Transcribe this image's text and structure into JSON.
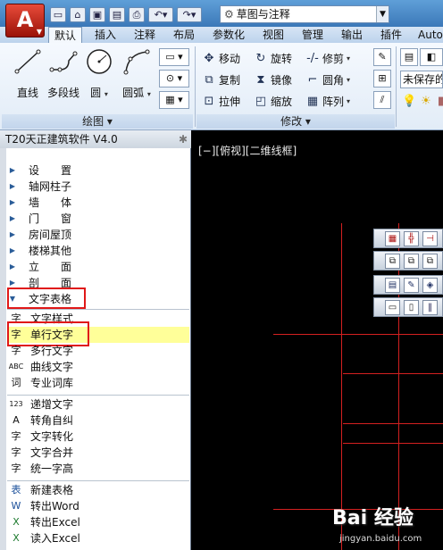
{
  "title_bar": {
    "app_logo": "A",
    "quick_access_icons": [
      "new-icon",
      "open-icon",
      "save-icon",
      "save-as-icon",
      "print-icon",
      "undo-icon",
      "redo-icon"
    ],
    "workspace": "草图与注释"
  },
  "tabs": [
    "默认",
    "插入",
    "注释",
    "布局",
    "参数化",
    "视图",
    "管理",
    "输出",
    "插件",
    "Auto"
  ],
  "active_tab": "默认",
  "ribbon": {
    "draw_tools": [
      {
        "label": "直线",
        "icon": "line-icon"
      },
      {
        "label": "多段线",
        "icon": "polyline-icon"
      },
      {
        "label": "圆",
        "icon": "circle-icon"
      },
      {
        "label": "圆弧",
        "icon": "arc-icon"
      }
    ],
    "draw_panel_title": "绘图",
    "modify_tools": [
      {
        "label": "移动",
        "icon": "move-icon"
      },
      {
        "label": "旋转",
        "icon": "rotate-icon"
      },
      {
        "label": "修剪",
        "icon": "trim-icon"
      },
      {
        "label": "复制",
        "icon": "copy-icon"
      },
      {
        "label": "镜像",
        "icon": "mirror-icon"
      },
      {
        "label": "圆角",
        "icon": "fillet-icon"
      },
      {
        "label": "拉伸",
        "icon": "stretch-icon"
      },
      {
        "label": "缩放",
        "icon": "scale-icon"
      },
      {
        "label": "阵列",
        "icon": "array-icon"
      }
    ],
    "modify_panel_title": "修改",
    "layer_state": "未保存的"
  },
  "palette": {
    "title": "T20天正建筑软件 V4.0",
    "categories": [
      "设　　置",
      "轴网柱子",
      "墙　　体",
      "门　　窗",
      "房间屋顶",
      "楼梯其他",
      "立　　面",
      "剖　　面",
      "文字表格"
    ],
    "text_items": [
      {
        "label": "文字样式",
        "icon": "字"
      },
      {
        "label": "单行文字",
        "icon": "字"
      },
      {
        "label": "多行文字",
        "icon": "字"
      },
      {
        "label": "曲线文字",
        "icon": "ABC"
      },
      {
        "label": "专业词库",
        "icon": "词"
      }
    ],
    "edit_items": [
      {
        "label": "递增文字",
        "icon": "123"
      },
      {
        "label": "转角自纠",
        "icon": "A"
      },
      {
        "label": "文字转化",
        "icon": "字"
      },
      {
        "label": "文字合并",
        "icon": "字"
      },
      {
        "label": "统一字高",
        "icon": "字"
      }
    ],
    "table_items": [
      {
        "label": "新建表格",
        "icon": "表"
      },
      {
        "label": "转出Word",
        "icon": "W"
      },
      {
        "label": "转出Excel",
        "icon": "X"
      },
      {
        "label": "读入Excel",
        "icon": "X"
      }
    ]
  },
  "viewport": {
    "label": "[−][俯视][二维线框]"
  },
  "watermark": {
    "brand": "Bai 经验",
    "url": "jingyan.baidu.com"
  },
  "colors": {
    "highlight": "#ffff99",
    "callout": "#e01818",
    "grid_line": "#d42020"
  }
}
